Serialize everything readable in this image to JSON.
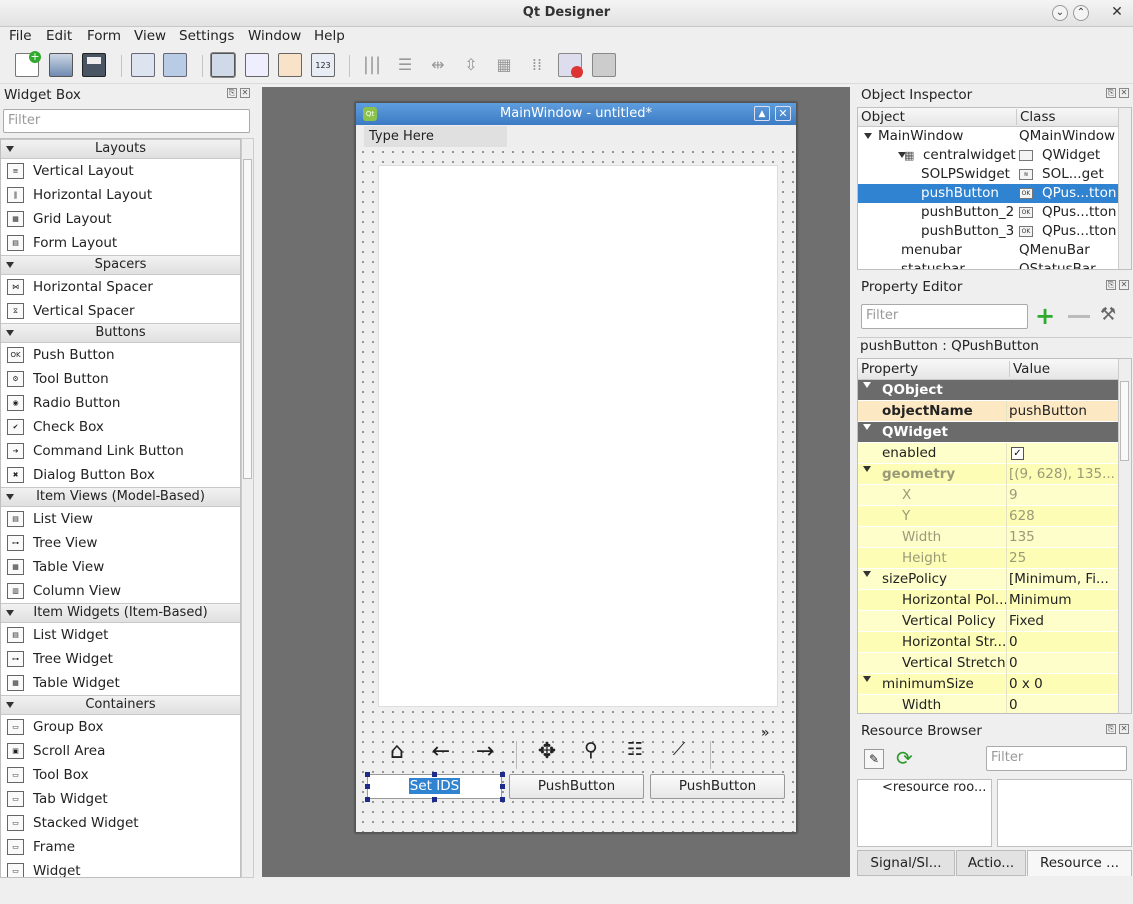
{
  "app": {
    "title": "Qt Designer"
  },
  "menu": {
    "file": "File",
    "edit": "Edit",
    "form": "Form",
    "view": "View",
    "settings": "Settings",
    "window": "Window",
    "help": "Help"
  },
  "widget_box": {
    "title": "Widget Box",
    "filter_placeholder": "Filter",
    "categories": [
      {
        "name": "Layouts",
        "items": [
          "Vertical Layout",
          "Horizontal Layout",
          "Grid Layout",
          "Form Layout"
        ]
      },
      {
        "name": "Spacers",
        "items": [
          "Horizontal Spacer",
          "Vertical Spacer"
        ]
      },
      {
        "name": "Buttons",
        "items": [
          "Push Button",
          "Tool Button",
          "Radio Button",
          "Check Box",
          "Command Link Button",
          "Dialog Button Box"
        ]
      },
      {
        "name": "Item Views (Model-Based)",
        "items": [
          "List View",
          "Tree View",
          "Table View",
          "Column View"
        ]
      },
      {
        "name": "Item Widgets (Item-Based)",
        "items": [
          "List Widget",
          "Tree Widget",
          "Table Widget"
        ]
      },
      {
        "name": "Containers",
        "items": [
          "Group Box",
          "Scroll Area",
          "Tool Box",
          "Tab Widget",
          "Stacked Widget",
          "Frame",
          "Widget"
        ]
      }
    ]
  },
  "form": {
    "title": "MainWindow - untitled*",
    "menu_placeholder": "Type Here",
    "buttons": [
      "Set IDS",
      "PushButton",
      "PushButton"
    ],
    "more": "»"
  },
  "object_inspector": {
    "title": "Object Inspector",
    "columns": [
      "Object",
      "Class"
    ],
    "rows": [
      {
        "object": "MainWindow",
        "class": "QMainWindow"
      },
      {
        "object": "centralwidget",
        "class": "QWidget"
      },
      {
        "object": "SOLPSwidget",
        "class": "SOL...get"
      },
      {
        "object": "pushButton",
        "class": "QPus...tton"
      },
      {
        "object": "pushButton_2",
        "class": "QPus...tton"
      },
      {
        "object": "pushButton_3",
        "class": "QPus...tton"
      },
      {
        "object": "menubar",
        "class": "QMenuBar"
      },
      {
        "object": "statusbar",
        "class": "QStatusBar"
      }
    ]
  },
  "property_editor": {
    "title": "Property Editor",
    "filter_placeholder": "Filter",
    "context": "pushButton : QPushButton",
    "columns": [
      "Property",
      "Value"
    ],
    "rows": [
      {
        "p": "QObject",
        "v": ""
      },
      {
        "p": "objectName",
        "v": "pushButton"
      },
      {
        "p": "QWidget",
        "v": ""
      },
      {
        "p": "enabled",
        "v": "✓"
      },
      {
        "p": "geometry",
        "v": "[(9, 628), 135..."
      },
      {
        "p": "X",
        "v": "9"
      },
      {
        "p": "Y",
        "v": "628"
      },
      {
        "p": "Width",
        "v": "135"
      },
      {
        "p": "Height",
        "v": "25"
      },
      {
        "p": "sizePolicy",
        "v": "[Minimum, Fi..."
      },
      {
        "p": "Horizontal Pol...",
        "v": "Minimum"
      },
      {
        "p": "Vertical Policy",
        "v": "Fixed"
      },
      {
        "p": "Horizontal Str...",
        "v": "0"
      },
      {
        "p": "Vertical Stretch",
        "v": "0"
      },
      {
        "p": "minimumSize",
        "v": "0 x 0"
      },
      {
        "p": "Width",
        "v": "0"
      }
    ]
  },
  "resource_browser": {
    "title": "Resource Browser",
    "filter_placeholder": "Filter",
    "root": "<resource roo..."
  },
  "tabs": [
    "Signal/Sl...",
    "Actio...",
    "Resource ..."
  ]
}
